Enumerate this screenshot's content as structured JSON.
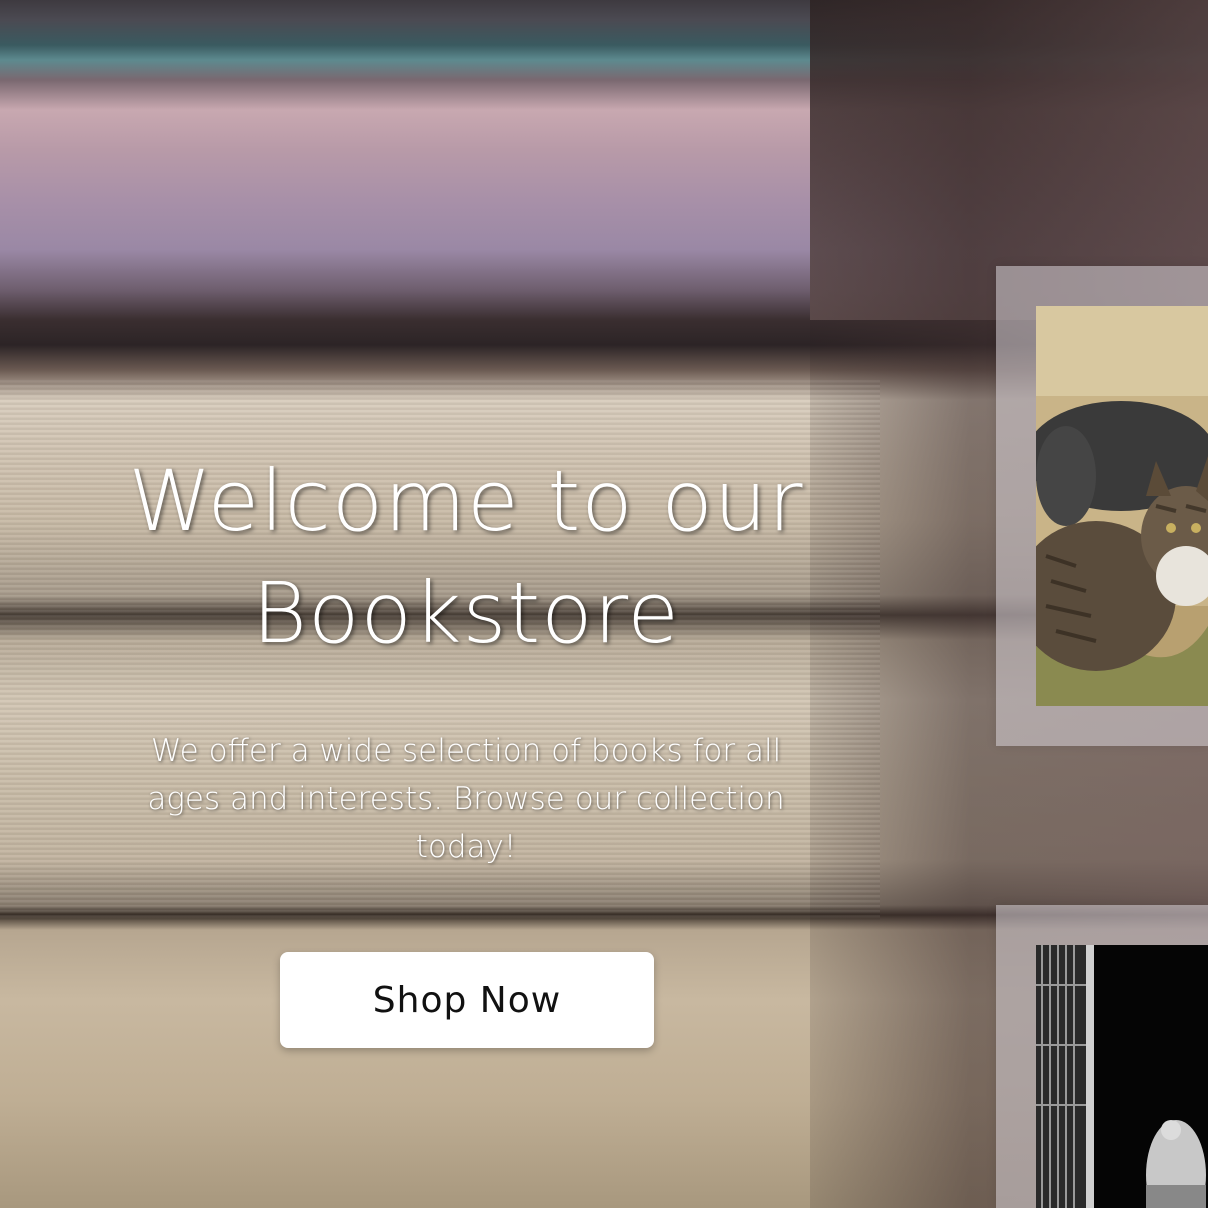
{
  "hero": {
    "title_line1": "Welcome to our",
    "title_line2": "Bookstore",
    "subtitle": "We offer a wide selection of books for all ages and interests. Browse our collection today!",
    "button_label": "Shop Now"
  },
  "gallery": {
    "items": [
      {
        "subject": "cats-photo"
      },
      {
        "subject": "street-photo-black-and-white"
      }
    ]
  },
  "colors": {
    "text": "#ffffff",
    "button_bg": "#ffffff",
    "button_text": "#111111"
  }
}
